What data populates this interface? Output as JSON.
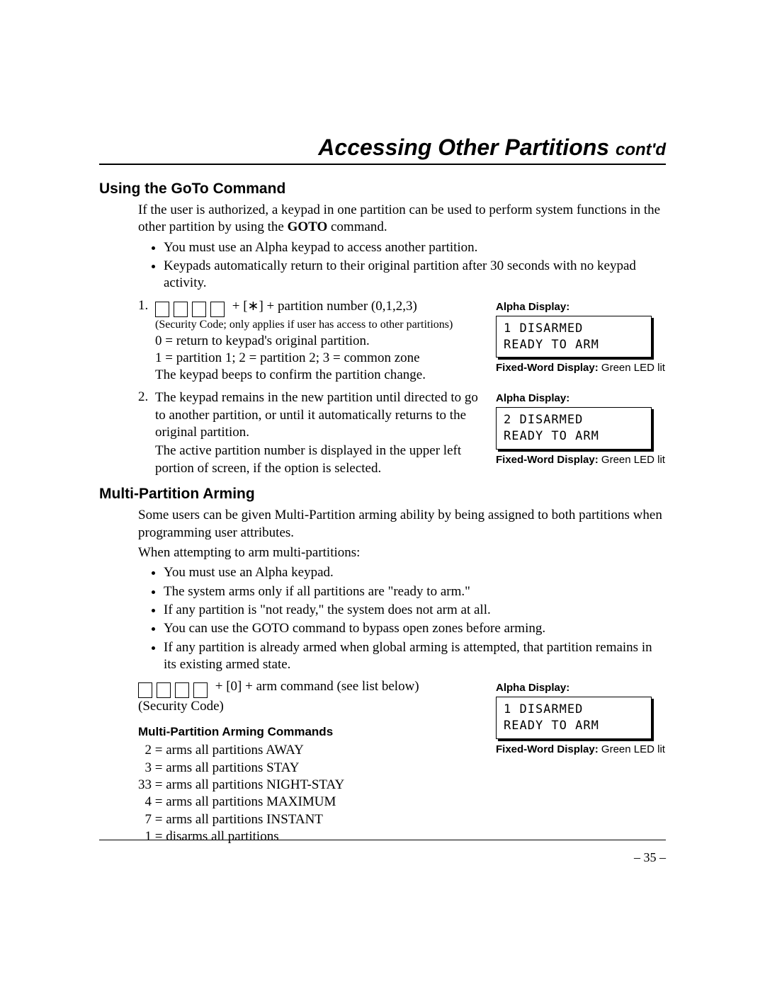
{
  "title_main": "Accessing Other Partitions ",
  "title_contd": "cont'd",
  "s1": {
    "heading": "Using the GoTo Command",
    "intro_a": "If the user is authorized, a keypad in one partition can be used to perform system functions in the other partition by using the ",
    "intro_bold": "GOTO",
    "intro_b": " command.",
    "bul1": "You must use an Alpha keypad to access another partition.",
    "bul2": "Keypads automatically return to their original partition after 30 seconds with no keypad activity.",
    "step1_num": "1.",
    "step1_tail": " +  [∗] + partition number (0,1,2,3)",
    "step1_note": "(Security Code; only applies if user has access to other partitions)",
    "step1_l0": "0 = return to keypad's original partition.",
    "step1_l1": "1 = partition 1; 2 = partition 2; 3 = common zone",
    "step1_l2": "The keypad beeps to confirm the partition change.",
    "step2_num": "2.",
    "step2_a": "The keypad remains in the new partition until directed to go to another partition, or until it automatically returns to the original partition.",
    "step2_b": "The active partition number is displayed in the upper left portion of screen, if the option is selected."
  },
  "disp": {
    "alpha_label": "Alpha Display:",
    "box1_l1": "1 DISARMED",
    "box1_l2": "READY TO ARM",
    "box2_l1": "2 DISARMED",
    "box2_l2": "READY TO ARM",
    "box3_l1": "1 DISARMED",
    "box3_l2": "READY TO ARM",
    "fixed_bold": "Fixed-Word Display:",
    "fixed_tail": " Green LED lit"
  },
  "s2": {
    "heading": "Multi-Partition Arming",
    "intro1": "Some users can be given Multi-Partition arming ability by being assigned to both partitions when programming user attributes.",
    "intro2": "When attempting to arm multi-partitions:",
    "bul1": "You must use an Alpha keypad.",
    "bul2": "The system arms only if all partitions are \"ready to arm.\"",
    "bul3": "If any partition is \"not ready,\" the system does not arm at all.",
    "bul4": "You can use the GOTO command to bypass open zones before arming.",
    "bul5": "If any partition is already armed when global arming is attempted, that partition remains in its existing armed state.",
    "armline_tail": " +  [0] + arm command (see list below)",
    "armline_note": "(Security Code)",
    "cmds_h": "Multi-Partition Arming Commands",
    "c1": "  2 = arms all partitions AWAY",
    "c2": "  3 = arms all partitions STAY",
    "c3": "33 = arms all partitions NIGHT-STAY",
    "c4": "  4 = arms all partitions MAXIMUM",
    "c5": "  7 = arms all partitions INSTANT",
    "c6": "  1 = disarms all partitions"
  },
  "pagenum": "– 35 –"
}
